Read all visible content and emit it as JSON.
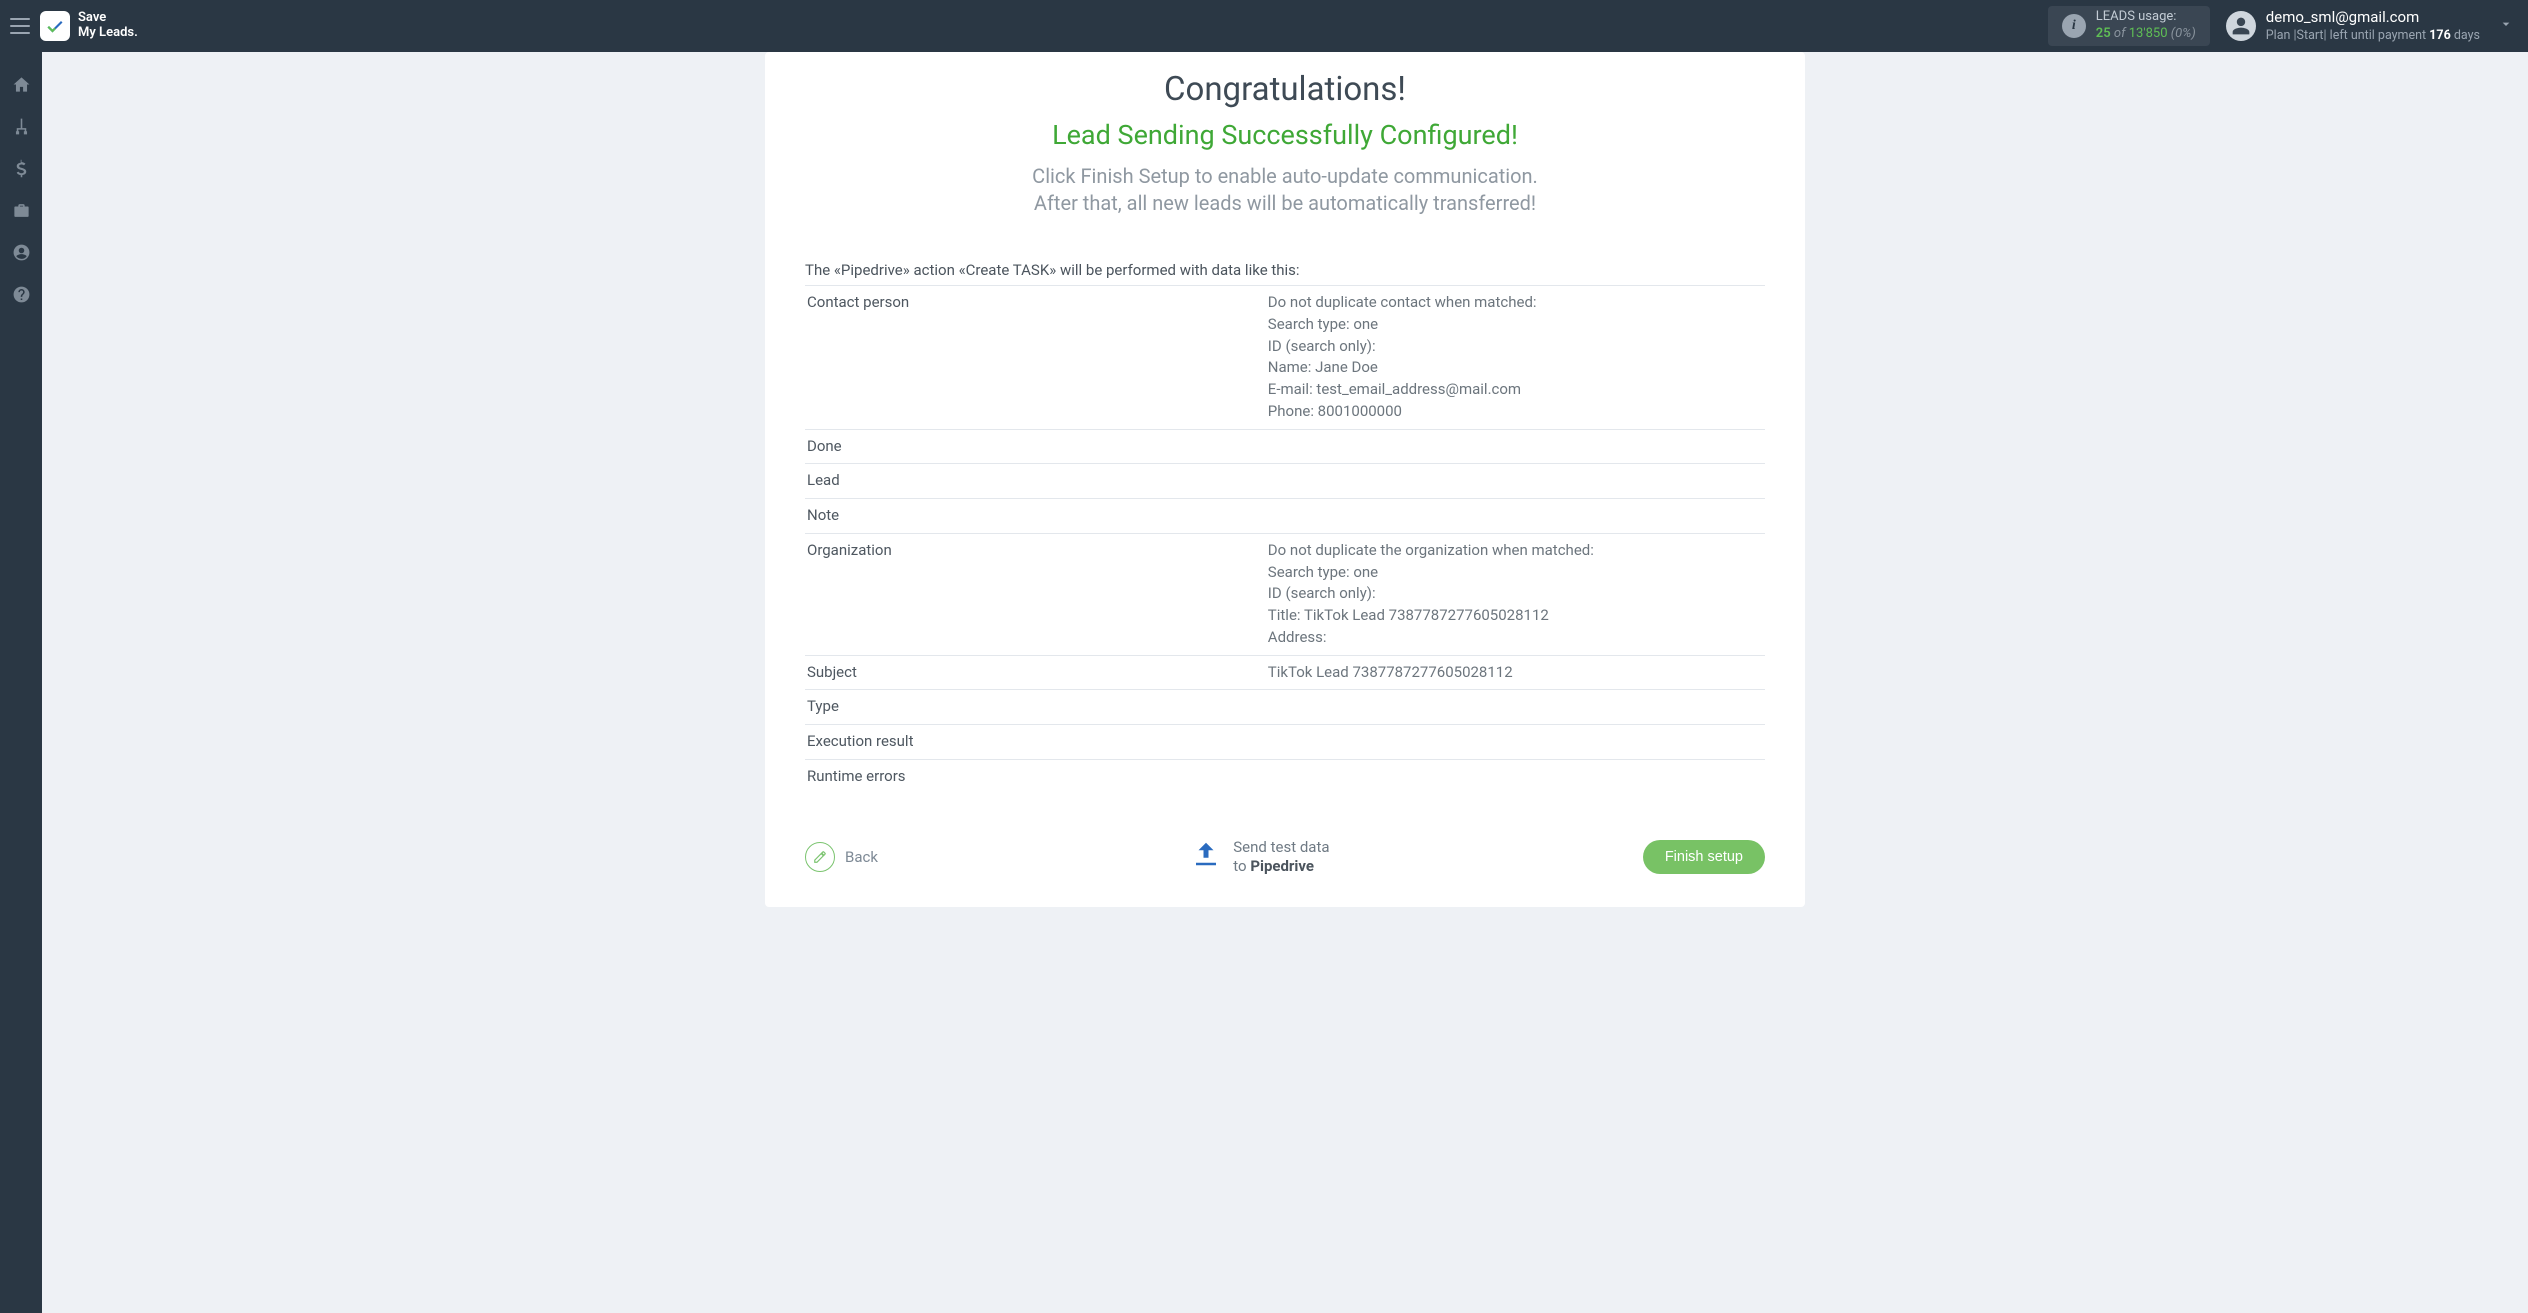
{
  "app": {
    "name_line1": "Save",
    "name_line2": "My Leads."
  },
  "usage": {
    "label": "LEADS usage:",
    "current": "25",
    "of": "of",
    "total": "13'850",
    "pct": "(0%)"
  },
  "account": {
    "email": "demo_sml@gmail.com",
    "plan_prefix": "Plan |Start| left until payment ",
    "days": "176",
    "days_suffix": " days"
  },
  "headings": {
    "congrats": "Congratulations!",
    "success": "Lead Sending Successfully Configured!",
    "desc_line1": "Click Finish Setup to enable auto-update communication.",
    "desc_line2": "After that, all new leads will be automatically transferred!"
  },
  "table": {
    "caption": "The «Pipedrive» action «Create TASK» will be performed with data like this:",
    "rows": [
      {
        "key": "Contact person",
        "val": "Do not duplicate contact when matched:\nSearch type: one\nID (search only):\nName: Jane Doe\nE-mail: test_email_address@mail.com\nPhone: 8001000000"
      },
      {
        "key": "Done",
        "val": ""
      },
      {
        "key": "Lead",
        "val": ""
      },
      {
        "key": "Note",
        "val": ""
      },
      {
        "key": "Organization",
        "val": "Do not duplicate the organization when matched:\nSearch type: one\nID (search only):\nTitle: TikTok Lead 7387787277605028112\nAddress:"
      },
      {
        "key": "Subject",
        "val": "TikTok Lead 7387787277605028112"
      },
      {
        "key": "Type",
        "val": ""
      },
      {
        "key": "Execution result",
        "val": ""
      },
      {
        "key": "Runtime errors",
        "val": ""
      }
    ]
  },
  "footer": {
    "back": "Back",
    "send_line1": "Send test data",
    "send_to": "to ",
    "send_dest": "Pipedrive",
    "finish": "Finish setup"
  }
}
